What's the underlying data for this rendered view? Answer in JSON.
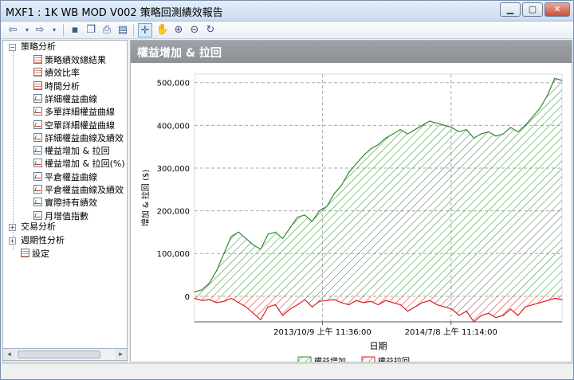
{
  "window": {
    "title": "MXF1 : 1K WB MOD V002 策略回測績效報告"
  },
  "window_buttons": {
    "minimize": "▁",
    "maximize": "▢",
    "close": "✕"
  },
  "toolbar": {
    "icons": [
      "back-icon",
      "forward-icon",
      "save-icon",
      "copy-icon",
      "print-icon",
      "table-icon",
      "pointer-icon",
      "pan-hand-icon",
      "zoom-in-icon",
      "zoom-out-icon",
      "reset-icon"
    ]
  },
  "tree": {
    "strategy": {
      "label": "策略分析",
      "items": [
        {
          "label": "策略績效總結果",
          "icon": "table"
        },
        {
          "label": "績效比率",
          "icon": "table"
        },
        {
          "label": "時間分析",
          "icon": "table"
        },
        {
          "label": "詳細權益曲線",
          "icon": "chart"
        },
        {
          "label": "多單詳細權益曲線",
          "icon": "chart"
        },
        {
          "label": "空單詳細權益曲線",
          "icon": "chart"
        },
        {
          "label": "詳細權益曲線及績效",
          "icon": "chart"
        },
        {
          "label": "權益增加 & 拉回",
          "icon": "chart"
        },
        {
          "label": "權益增加 & 拉回(%)",
          "icon": "chart"
        },
        {
          "label": "平倉權益曲線",
          "icon": "chart"
        },
        {
          "label": "平倉權益曲線及績效",
          "icon": "chart"
        },
        {
          "label": "實際持有績效",
          "icon": "chart"
        },
        {
          "label": "月增值指數",
          "icon": "chart"
        }
      ]
    },
    "trade": {
      "label": "交易分析"
    },
    "period": {
      "label": "週期性分析"
    },
    "settings": {
      "label": "設定"
    }
  },
  "panel": {
    "title": "權益增加 & 拉回"
  },
  "chart_data": {
    "type": "area",
    "title": "",
    "xlabel": "日期",
    "ylabel": "增加 & 拉回 ($)",
    "ylim": [
      -60000,
      520000
    ],
    "yticks": [
      0,
      100000,
      200000,
      300000,
      400000,
      500000
    ],
    "ytick_labels": [
      "0",
      "100,000",
      "200,000",
      "300,000",
      "400,000",
      "500,000"
    ],
    "xtick_labels": [
      "2013/10/9 上午 11:36:00",
      "2014/7/8 上午 11:14:00"
    ],
    "xtick_positions": [
      0.348,
      0.698
    ],
    "grid": true,
    "legend_position": "bottom-center",
    "colors": {
      "runup": "#2e8b2e",
      "drawdown": "#d62020"
    },
    "series": [
      {
        "name": "權益增加",
        "x": [
          0.0,
          0.02,
          0.04,
          0.06,
          0.08,
          0.1,
          0.12,
          0.14,
          0.16,
          0.18,
          0.2,
          0.22,
          0.24,
          0.26,
          0.28,
          0.3,
          0.32,
          0.34,
          0.36,
          0.38,
          0.4,
          0.42,
          0.44,
          0.46,
          0.48,
          0.5,
          0.52,
          0.54,
          0.56,
          0.58,
          0.6,
          0.62,
          0.64,
          0.66,
          0.68,
          0.7,
          0.72,
          0.74,
          0.76,
          0.78,
          0.8,
          0.82,
          0.84,
          0.86,
          0.88,
          0.9,
          0.92,
          0.94,
          0.96,
          0.98,
          1.0
        ],
        "values": [
          10000,
          15000,
          30000,
          60000,
          100000,
          140000,
          150000,
          135000,
          120000,
          110000,
          145000,
          150000,
          135000,
          160000,
          185000,
          190000,
          175000,
          200000,
          210000,
          240000,
          260000,
          290000,
          310000,
          330000,
          345000,
          355000,
          370000,
          380000,
          390000,
          380000,
          390000,
          400000,
          410000,
          405000,
          400000,
          395000,
          385000,
          390000,
          370000,
          380000,
          385000,
          375000,
          380000,
          395000,
          385000,
          400000,
          420000,
          440000,
          470000,
          510000,
          505000
        ]
      },
      {
        "name": "權益拉回",
        "x": [
          0.0,
          0.02,
          0.04,
          0.06,
          0.08,
          0.1,
          0.12,
          0.14,
          0.16,
          0.18,
          0.2,
          0.22,
          0.24,
          0.26,
          0.28,
          0.3,
          0.32,
          0.34,
          0.36,
          0.38,
          0.4,
          0.42,
          0.44,
          0.46,
          0.48,
          0.5,
          0.52,
          0.54,
          0.56,
          0.58,
          0.6,
          0.62,
          0.64,
          0.66,
          0.68,
          0.7,
          0.72,
          0.74,
          0.76,
          0.78,
          0.8,
          0.82,
          0.84,
          0.86,
          0.88,
          0.9,
          0.92,
          0.94,
          0.96,
          0.98,
          1.0
        ],
        "values": [
          -5000,
          -10000,
          -8000,
          -15000,
          -12000,
          -5000,
          -15000,
          -25000,
          -40000,
          -55000,
          -25000,
          -20000,
          -45000,
          -30000,
          -20000,
          -8000,
          -25000,
          -12000,
          -10000,
          -8000,
          -15000,
          -20000,
          -10000,
          -15000,
          -12000,
          -20000,
          -10000,
          -15000,
          -20000,
          -35000,
          -25000,
          -15000,
          -10000,
          -20000,
          -25000,
          -30000,
          -45000,
          -35000,
          -60000,
          -45000,
          -40000,
          -50000,
          -45000,
          -30000,
          -45000,
          -25000,
          -20000,
          -15000,
          -10000,
          -5000,
          -8000
        ]
      }
    ]
  }
}
